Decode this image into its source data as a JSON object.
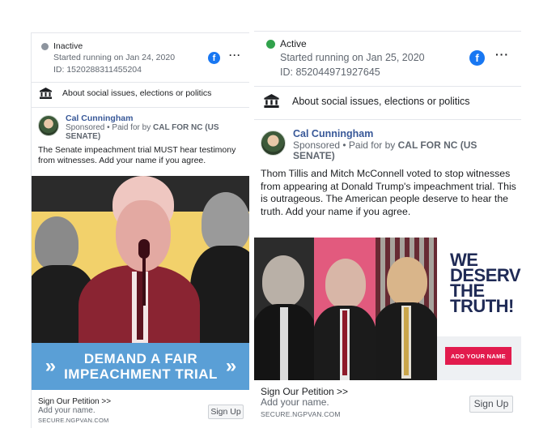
{
  "ads": [
    {
      "status": "Inactive",
      "status_color": "#8d949e",
      "started": "Started running on Jan 24, 2020",
      "id": "ID: 1520288311455204",
      "category": "About social issues, elections or politics",
      "advertiser": "Cal Cunningham",
      "sponsored_prefix": "Sponsored • Paid for by",
      "paid_by": "CAL FOR NC (US SENATE)",
      "body": "The Senate impeachment trial MUST hear testimony from witnesses. Add your name if you agree.",
      "creative_banner": [
        "DEMAND A FAIR",
        "IMPEACHMENT TRIAL"
      ],
      "cta_title": "Sign Our Petition >>",
      "cta_subtitle": "Add your name.",
      "cta_domain": "SECURE.NGPVAN.COM",
      "cta_button": "Sign Up"
    },
    {
      "status": "Active",
      "status_color": "#31a24c",
      "started": "Started running on Jan 25, 2020",
      "id": "ID: 852044971927645",
      "category": "About social issues, elections or politics",
      "advertiser": "Cal Cunningham",
      "sponsored_prefix": "Sponsored • Paid for by",
      "paid_by": "CAL FOR NC (US SENATE)",
      "body": "Thom Tillis and Mitch McConnell voted to stop witnesses from appearing at Donald Trump's impeachment trial. This is outrageous. The American people deserve to hear the truth. Add your name if you agree.",
      "creative_headline": [
        "WE",
        "DESERVE",
        "THE",
        "TRUTH!"
      ],
      "creative_button": "ADD YOUR NAME",
      "cta_title": "Sign Our Petition >>",
      "cta_subtitle": "Add your name.",
      "cta_domain": "SECURE.NGPVAN.COM",
      "cta_button": "Sign Up"
    }
  ],
  "icons": {
    "platform": "facebook-icon",
    "more": "more-options-icon",
    "category": "government-building-icon"
  },
  "colors": {
    "facebook_blue": "#1877f2",
    "advertiser_link": "#385898",
    "banner_blue": "#5a9fd6",
    "headline_navy": "#1f2a55",
    "button_red": "#e21b4d",
    "pink_panel": "#e25a7e"
  }
}
